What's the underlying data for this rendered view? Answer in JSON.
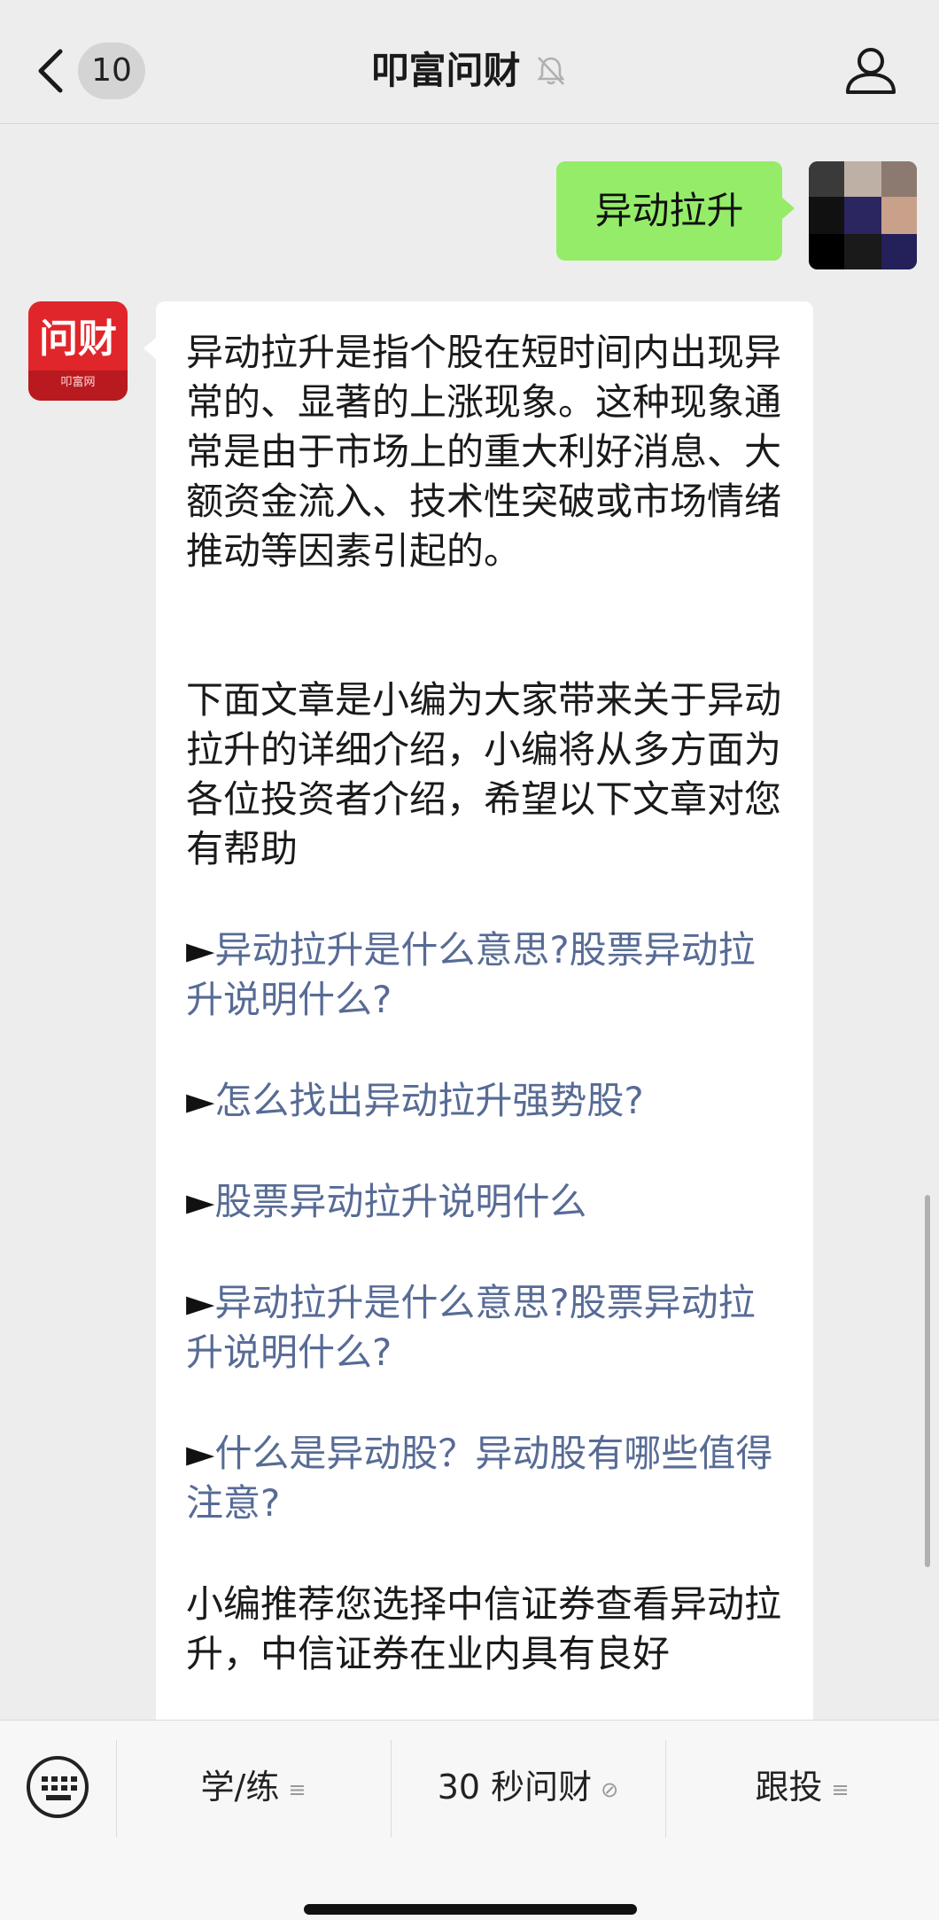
{
  "header": {
    "back_icon": "chevron-left-icon",
    "unread_badge": "10",
    "title": "叩富问财",
    "mute_icon": "bell-muted-icon",
    "profile_icon": "user-icon"
  },
  "messages": {
    "user": {
      "text": "异动拉升"
    },
    "bot": {
      "intro": "异动拉升是指个股在短时间内出现异常的、显著的上涨现象。这种现象通常是由于市场上的重大利好消息、大额资金流入、技术性突破或市场情绪推动等因素引起的。",
      "lead": "下面文章是小编为大家带来关于异动拉升的详细介绍，小编将从多方面为各位投资者介绍，希望以下文章对您有帮助",
      "bullet_marker": "►",
      "links": [
        "异动拉升是什么意思?股票异动拉升说明什么?",
        "怎么找出异动拉升强势股?",
        "股票异动拉升说明什么",
        "异动拉升是什么意思?股票异动拉升说明什么?",
        "什么是异动股？异动股有哪些值得注意?"
      ],
      "closing": "小编推荐您选择中信证券查看异动拉升，中信证券在业内具有良好"
    },
    "bot_avatar": {
      "logo_text": "问财",
      "logo_sub": "叩富网"
    }
  },
  "bottom_menu": {
    "keyboard_icon": "keyboard-icon",
    "items": [
      {
        "label": "学/练",
        "icon": "menu-lines-icon"
      },
      {
        "label": "30 秒问财",
        "icon": "mini-program-icon"
      },
      {
        "label": "跟投",
        "icon": "menu-lines-icon"
      }
    ]
  },
  "colors": {
    "user_bubble": "#95ec69",
    "link": "#576b95",
    "brand_red": "#e0262b"
  }
}
